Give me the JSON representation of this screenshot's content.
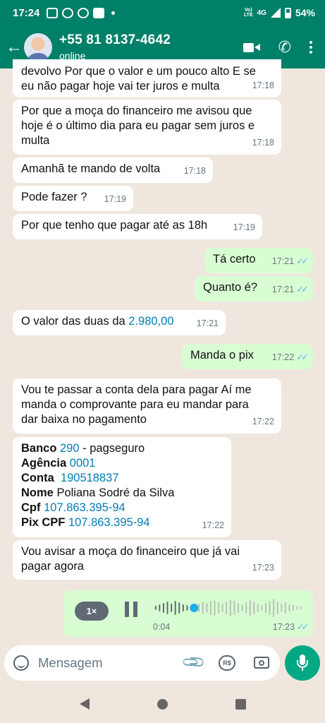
{
  "status_bar": {
    "time": "17:24",
    "network": "Vo) LTE",
    "network_type": "4G",
    "battery": "54%",
    "battery_level": 0.54
  },
  "header": {
    "back_icon": "arrow-left-icon",
    "contact_name": "+55 81 8137-4642",
    "contact_status": "online",
    "icons": [
      "video-call-icon",
      "phone-icon",
      "more-vertical-icon"
    ]
  },
  "messages": [
    {
      "dir": "in",
      "lines": [
        "devolvo Por que o valor e um pouco alto E se",
        "eu não pagar hoje vai ter juros e multa"
      ],
      "time": "17:18"
    },
    {
      "dir": "in",
      "lines": [
        "Por que a moça do financeiro me avisou que",
        "hoje é o último dia para eu pagar sem juros e",
        "multa"
      ],
      "time": "17:18"
    },
    {
      "dir": "in",
      "lines": [
        "Amanhã te mando de volta"
      ],
      "time": "17:18"
    },
    {
      "dir": "in",
      "lines": [
        "Pode fazer ?"
      ],
      "time": "17:19"
    },
    {
      "dir": "in",
      "lines": [
        "Por que tenho que pagar até as 18h"
      ],
      "time": "17:19"
    },
    {
      "dir": "out",
      "lines": [
        "Tá certo"
      ],
      "time": "17:21",
      "ticks": "✓✓"
    },
    {
      "dir": "out",
      "lines": [
        "Quanto é?"
      ],
      "time": "17:21",
      "ticks": "✓✓"
    },
    {
      "dir": "in",
      "text_prefix": "O valor das duas da ",
      "link": "2.980,00",
      "time": "17:21"
    },
    {
      "dir": "out",
      "lines": [
        "Manda o pix"
      ],
      "time": "17:22",
      "ticks": "✓✓"
    },
    {
      "dir": "in",
      "lines": [
        "Vou te passar a conta dela para pagar Aí me",
        "manda o comprovante para eu mandar para",
        "dar baixa no pagamento"
      ],
      "time": "17:22"
    },
    {
      "dir": "in",
      "bank": {
        "rows": [
          {
            "label": "Banco",
            "link": "290",
            "rest": " - pagseguro"
          },
          {
            "label": "Agência",
            "link": "0001",
            "rest": ""
          },
          {
            "label": "Conta",
            "link": "190518837",
            "rest": ""
          },
          {
            "label": "Nome",
            "link": "",
            "rest": "Poliana Sodré da Silva"
          },
          {
            "label": "Cpf",
            "link": "107.863.395-94",
            "rest": ""
          },
          {
            "label": "Pix CPF",
            "link": "107.863.395-94",
            "rest": ""
          }
        ]
      },
      "time": "17:22"
    },
    {
      "dir": "in",
      "lines": [
        "Vou avisar a moça do financeiro que já vai",
        "pagar agora"
      ],
      "time": "17:23"
    }
  ],
  "voice_note": {
    "speed_label": "1×",
    "duration": "0:04",
    "time": "17:23",
    "ticks": "✓✓",
    "progress": 0.27
  },
  "input": {
    "placeholder": "Mensagem",
    "icons": [
      "emoji-icon",
      "attach-clip-icon",
      "payment-rs-icon",
      "camera-icon"
    ],
    "payment_label": "R$",
    "mic_icon": "microphone-icon"
  },
  "nav_bar": {
    "icons": [
      "nav-back-icon",
      "nav-home-icon",
      "nav-recents-icon"
    ]
  },
  "colors": {
    "header": "#008069",
    "chat_bg": "#efe7de",
    "incoming": "#ffffff",
    "outgoing": "#d9fdd3",
    "link": "#027eb5",
    "read_ticks": "#53bdeb",
    "mic_button": "#00a884"
  }
}
